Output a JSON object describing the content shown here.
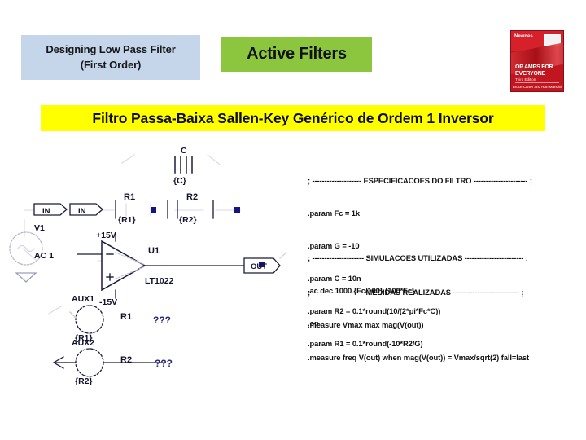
{
  "slide": {
    "header_label": "Designing Low Pass Filter\n(First Order)",
    "header_line1": "Designing Low Pass Filter",
    "header_line2": "(First Order)",
    "section_title": "Active Filters",
    "banner_title": "Filtro Passa-Baixa Sallen-Key Genérico de Ordem 1 Inversor",
    "colors": {
      "header_bg": "#c6d6ea",
      "section_bg": "#8cc63e",
      "banner_bg": "#ffff00",
      "wire": "#1a1a3c",
      "junction": "#15157f",
      "unknown_marker": "#2a2a7a",
      "book_red": "#c1161f"
    }
  },
  "book_cover": {
    "publisher": "Newnes",
    "title_line1": "OP AMPS FOR",
    "title_line2": "EVERYONE",
    "edition": "Third Edition",
    "author": "Bruce Carter and Ron Mancini"
  },
  "schematic": {
    "ports": [
      {
        "name": "IN",
        "label": "IN"
      },
      {
        "name": "IN",
        "label": "IN"
      },
      {
        "name": "OUT",
        "label": "OUT"
      }
    ],
    "components": [
      {
        "ref": "V1",
        "value": "AC 1",
        "type": "voltage-source"
      },
      {
        "ref": "R1",
        "value": "{R1}",
        "type": "resistor"
      },
      {
        "ref": "R2",
        "value": "{R2}",
        "type": "resistor"
      },
      {
        "ref": "C",
        "value": "{C}",
        "type": "capacitor"
      },
      {
        "ref": "U1",
        "value": "LT1022",
        "type": "opamp"
      },
      {
        "ref": "AUX1",
        "value": "{R1}",
        "sub": "R1",
        "type": "aux-source"
      },
      {
        "ref": "AUX2",
        "value": "{R2}",
        "sub": "R2",
        "type": "aux-source"
      }
    ],
    "rails": {
      "positive": "+15V",
      "negative": "-15V"
    },
    "unknown_markers": [
      "???",
      "???"
    ]
  },
  "netlist": {
    "specs": [
      "; -------------------- ESPECIFICACOES DO FILTRO ---------------------- ;",
      ".param Fc = 1k",
      ".param G = -10",
      ".param C = 10n",
      ".param R2 = 0.1*round(10/(2*pi*Fc*C))",
      ".param R1 = 0.1*round(-10*R2/G)"
    ],
    "simulations": [
      "; --------------------- SIMULACOES UTILIZADAS ------------------------ ;",
      ".ac dec 1000 {Fc/100} {100*Fc}",
      ".op"
    ],
    "measurements": [
      "; --------------------- MEDIDAS REALIZADAS --------------------------- ;",
      ".measure Vmax max mag(V(out))",
      ".measure freq V(out) when mag(V(out)) = Vmax/sqrt(2) fall=last"
    ]
  }
}
